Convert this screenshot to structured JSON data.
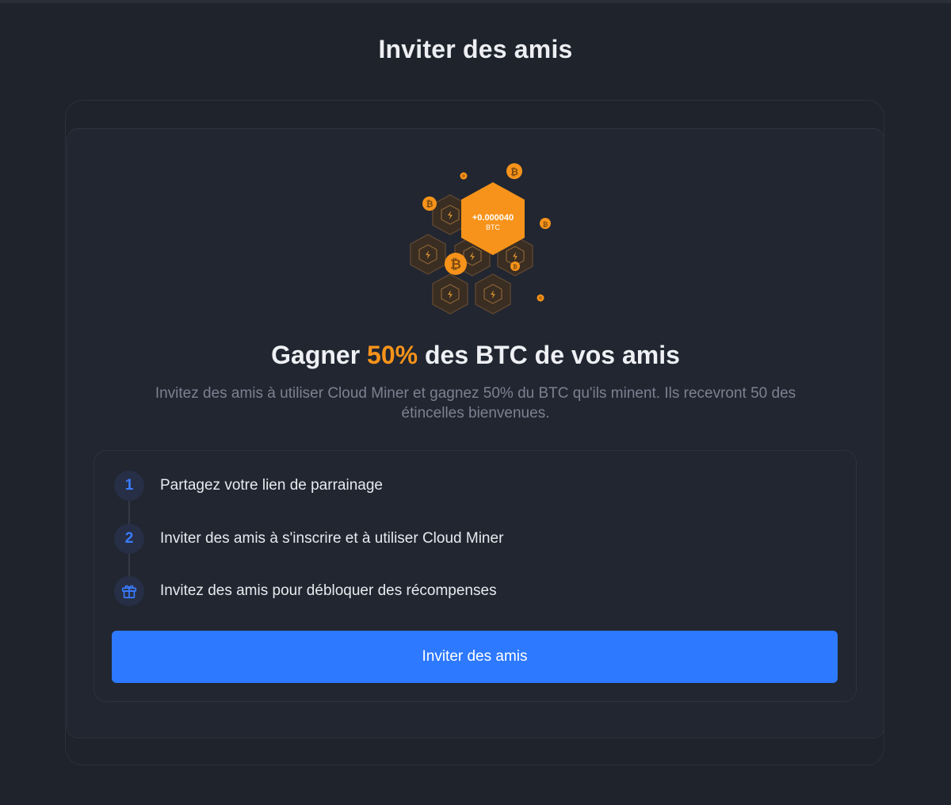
{
  "page": {
    "title": "Inviter des amis"
  },
  "hero": {
    "reward_amount": "+0.000040",
    "reward_currency": "BTC",
    "accent_color": "#f7931a"
  },
  "headline": {
    "prefix": "Gagner ",
    "highlight": "50%",
    "suffix": " des BTC de vos amis"
  },
  "subtitle": "Invitez des amis à utiliser Cloud Miner et gagnez 50% du BTC qu'ils minent. Ils recevront 50 des étincelles bienvenues.",
  "steps": [
    {
      "badge": "1",
      "label": "Partagez votre lien de parrainage"
    },
    {
      "badge": "2",
      "label": "Inviter des amis à s'inscrire et à utiliser Cloud Miner"
    },
    {
      "badge": "gift-icon",
      "label": "Invitez des amis pour débloquer des récompenses"
    }
  ],
  "invite_button": {
    "label": "Inviter des amis",
    "color": "#2d79ff"
  }
}
